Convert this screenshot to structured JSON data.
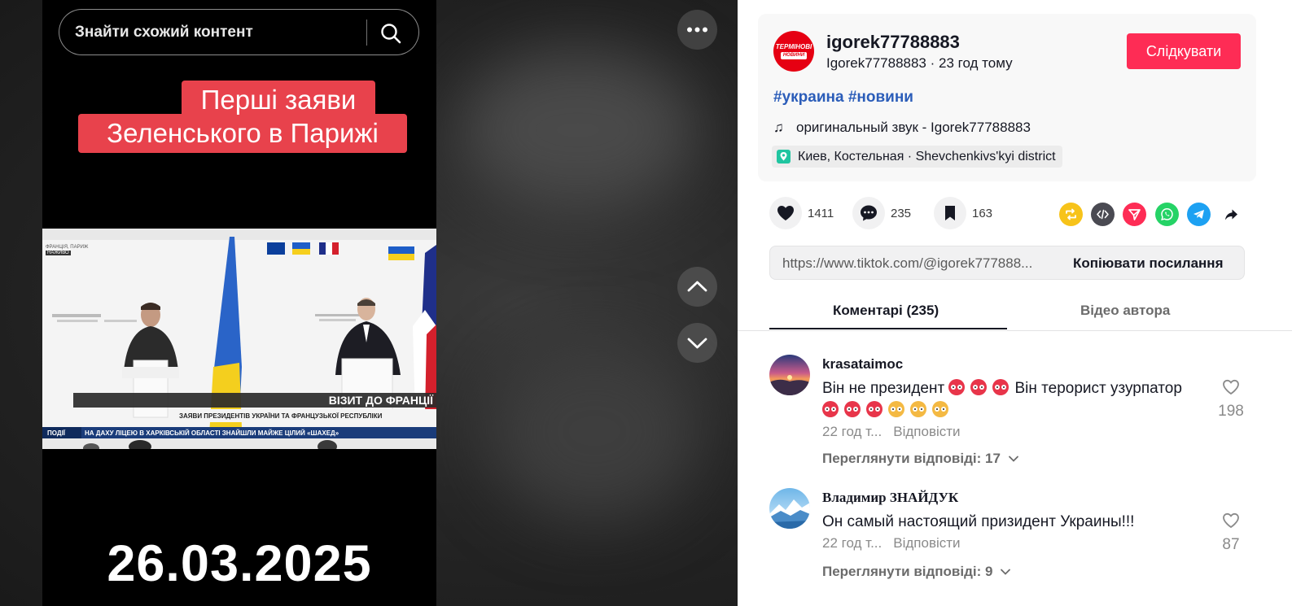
{
  "player": {
    "search_placeholder": "Знайти схожий контент",
    "caption_line1": "Перші заяви",
    "caption_line2": "Зеленського в Парижі",
    "date_overlay": "26.03.2025",
    "clip": {
      "tag_top": "ФРАНЦІЯ, ПАРИЖ",
      "tag_live": "НАЖИВО",
      "lower_third_title": "ВІЗИТ ДО ФРАНЦІЇ",
      "lower_third_sub": "ЗАЯВИ ПРЕЗИДЕНТІВ УКРАЇНИ ТА ФРАНЦУЗЬКОЇ РЕСПУБЛІКИ",
      "ticker_label": "ПОДІЇ",
      "ticker_text": "НА ДАХУ ЛІЦЕЮ В ХАРКІВСЬКІЙ ОБЛАСТІ ЗНАЙШЛИ МАЙЖЕ ЦІЛИЙ «ШАХЕД»"
    }
  },
  "author": {
    "avatar_line1": "ТЕРМІНОВІ",
    "avatar_line2": "НОВИНИ",
    "username": "igorek77788883",
    "subline": "Igorek77788883 · 23 год тому",
    "follow_label": "Слідкувати"
  },
  "post": {
    "hashtags": "#украина #новини",
    "music": "оригинальный звук - Igorek77788883",
    "location": "Киев, Костельная · Shevchenkivs'kyi district"
  },
  "actions": {
    "likes": "1411",
    "comments": "235",
    "saves": "163"
  },
  "link": {
    "url": "https://www.tiktok.com/@igorek777888...",
    "copy_label": "Копіювати посилання"
  },
  "tabs": {
    "comments": "Коментарі (235)",
    "author_videos": "Відео автора"
  },
  "comments": [
    {
      "user": "krasataimoc",
      "text_part1": "Він не президент",
      "text_part2": "Він терорист узурпатор",
      "time": "22 год т...",
      "reply": "Відповісти",
      "replies": "Переглянути відповіді: 17",
      "likes": "198"
    },
    {
      "user": "Владимир ЗНАЙДУК",
      "text": "Он самый настоящий призидент Украины!!!",
      "time": "22 год т...",
      "reply": "Відповісти",
      "replies": "Переглянути відповіді: 9",
      "likes": "87"
    }
  ],
  "colors": {
    "accent": "#fe2c55",
    "hashtag": "#2b5db9",
    "caption_bg": "#e8424c"
  }
}
